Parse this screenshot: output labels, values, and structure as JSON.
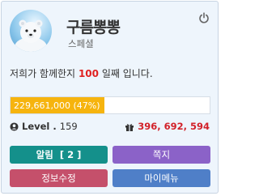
{
  "profile": {
    "username": "구름뽕뽕",
    "rank": "스페셜",
    "avatar_icon": "polar-bear-avatar"
  },
  "membership": {
    "prefix": "저희가 함께한지",
    "days": "100",
    "suffix": "일째 입니다."
  },
  "experience": {
    "label": "229,661,000 (47%)",
    "percent": 47
  },
  "level": {
    "label": "Level .",
    "value": "159"
  },
  "points": {
    "value": "396, 692, 594"
  },
  "buttons": {
    "alarm_label": "알림",
    "alarm_count": "[ 2 ]",
    "note_label": "쪽지",
    "info_edit_label": "정보수정",
    "my_menu_label": "마이메뉴"
  },
  "colors": {
    "exp_fill": "#f6b40e",
    "alarm_button": "#14908b",
    "note_button": "#8b62c8",
    "info_button": "#c5506b",
    "menu_button": "#4f7fc8",
    "highlight_red": "#d2222a"
  }
}
